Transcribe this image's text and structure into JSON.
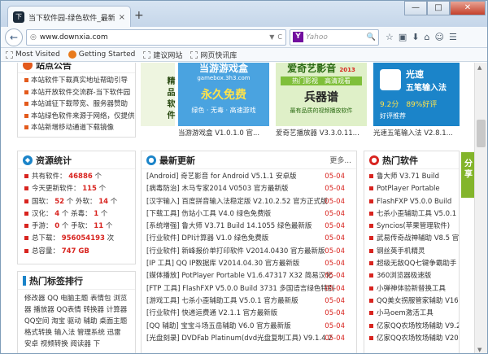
{
  "tab": {
    "favicon": "下",
    "title": "当下软件园-绿色软件_最新绿...",
    "close": "×"
  },
  "new_tab": "+",
  "window": {
    "min": "—",
    "max": "□",
    "close": "✕"
  },
  "nav": {
    "back": "←",
    "url": "www.downxia.com",
    "reload": "C",
    "dropdown": "▼",
    "globe": "◎"
  },
  "search": {
    "engine": "Y",
    "placeholder": "Yahoo",
    "btn": "🔍"
  },
  "toolbar_icons": [
    "☆",
    "▣",
    "⬇",
    "⌂",
    "☺",
    "☰"
  ],
  "bookmarks": [
    "Most Visited",
    "Getting Started",
    "建议网站",
    "网页快讯库"
  ],
  "notice": {
    "title": "站点公告",
    "items": [
      "本站软件下载真实地址帮助引导",
      "本站开放软件交流群-当下软件园",
      "本站诚征下载带宽、服务器赞助",
      "本站绿色软件来源于网络，仅提供",
      "本站新增移动通道下载镜像"
    ]
  },
  "featured": [
    {
      "vert": "精品软件",
      "caption": "当游游戏盒 V1.0.1.0 官...",
      "img_top": "当游游戏盒",
      "img_sub": "gamebox.3h3.com",
      "img_big": "永久免费",
      "img_tags": "绿色 · 无毒 · 高速游戏",
      "color": "#4aa3e0"
    },
    {
      "caption": "爱奇艺播放器 V3.3.0.11...",
      "img_top": "爱奇艺影音",
      "img_year": "2013",
      "img_sub": "热门影视　高清观看",
      "img_big": "兵器谱",
      "img_tags": "最有品质的视频播放软件",
      "color": "#7fbf3a"
    },
    {
      "caption": "光速五笔输入法 V2.8.1...",
      "img_top": "光速",
      "img_sub": "五笔输入法",
      "img_big": "9.2分　89%好评",
      "img_tags": "好评推荐",
      "color": "#1b84c9"
    }
  ],
  "stats": {
    "title": "资源统计",
    "rows": [
      {
        "label": "共有软件：",
        "v1": "46886",
        "u1": "个"
      },
      {
        "label": "今天更新软件：",
        "v1": "115",
        "u1": "个"
      },
      {
        "label": "国软：",
        "v1": "52",
        "u1": "个",
        "label2": "外软：",
        "v2": "14",
        "u2": "个"
      },
      {
        "label": "汉化：",
        "v1": "4",
        "u1": "个",
        "label2": "杀毒：",
        "v2": "1",
        "u2": "个"
      },
      {
        "label": "手游：",
        "v1": "0",
        "u1": "个",
        "label2": "手软：",
        "v2": "11",
        "u2": "个"
      },
      {
        "label": "总下载：",
        "v1": "956054193",
        "u1": "次"
      },
      {
        "label": "总容量：",
        "v1": "747 GB",
        "u1": ""
      }
    ]
  },
  "tags": {
    "title": "热门标签排行",
    "text": "修改器 QQ 电脑主题 表情包 浏览器 播放器 QQ表情 转换器 计算器 QQ空间 淘宝 驱动 辅助 桌面主题 格式转换 输入法 管理系统 迅雷 安卓 视频转换 阅读器 下"
  },
  "latest": {
    "title": "最新更新",
    "more": "更多...",
    "items": [
      {
        "t": "[Android] 奇艺影音 for Android V5.1.1 安卓版",
        "d": "05-04"
      },
      {
        "t": "[病毒防治] 木马专家2014 V0503 官方最新版",
        "d": "05-04"
      },
      {
        "t": "[汉字输入] 百度拼音输入法稳定版 V2.10.2.52 官方正式版",
        "d": "05-04"
      },
      {
        "t": "[下载工具] 伤站小工具 V4.0 绿色免费版",
        "d": "05-04"
      },
      {
        "t": "[系统增强] 鲁大师 V3.71 Build 14.1055 绿色最新版",
        "d": "05-04"
      },
      {
        "t": "[行业软件] DPI计算器 V1.0 绿色免费版",
        "d": "05-04"
      },
      {
        "t": "[行业软件] 新峰报价单打印软件 V2014.0430 官方最新版",
        "d": "05-04"
      },
      {
        "t": "[IP 工具] QQ IP数据库 V2014.04.30 官方最新版",
        "d": "05-04"
      },
      {
        "t": "[媒体播放] PotPlayer Portable V1.6.47317 X32 简易汉化",
        "d": "05-04"
      },
      {
        "t": "[FTP 工具] FlashFXP V5.0.0 Build 3731 多国语言绿色特别",
        "d": "05-04"
      },
      {
        "t": "[游戏工具] 七杀小歪辅助工具 V5.0.1 官方最新版",
        "d": "05-04"
      },
      {
        "t": "[行业软件] 快递运费通 V2.1.1 官方最新版",
        "d": "05-04"
      },
      {
        "t": "[QQ 辅助] 宝宝斗场五岳辅助 V6.0 官方最新版",
        "d": "05-04"
      },
      {
        "t": "[光盘刻录] DVDFab Platinum(dvd光盘复制工具) V9.1.4.2",
        "d": "05-04"
      }
    ]
  },
  "hot": {
    "title": "热门软件",
    "items": [
      "鲁大师 V3.71 Build",
      "PotPlayer Portable",
      "FlashFXP V5.0.0 Build",
      "七杀小歪辅助工具 V5.0.1",
      "Syncios(苹果管理软件)",
      "武易传奇战神辅助 V8.5 官",
      "钢丝英手机精灵",
      "超级无敌QQ七键争霸助手",
      "360浏览器极速版",
      "小弹神体验新替换工具",
      "QQ美女拐服管家辅助 V16.2",
      "小马oem激活工具",
      "亿家QQ农场牧场辅助 V9.2",
      "亿家QQ农场牧场辅助 V2014"
    ]
  },
  "share": "分享",
  "scroll": {
    "up": "▲",
    "down": "▼"
  }
}
